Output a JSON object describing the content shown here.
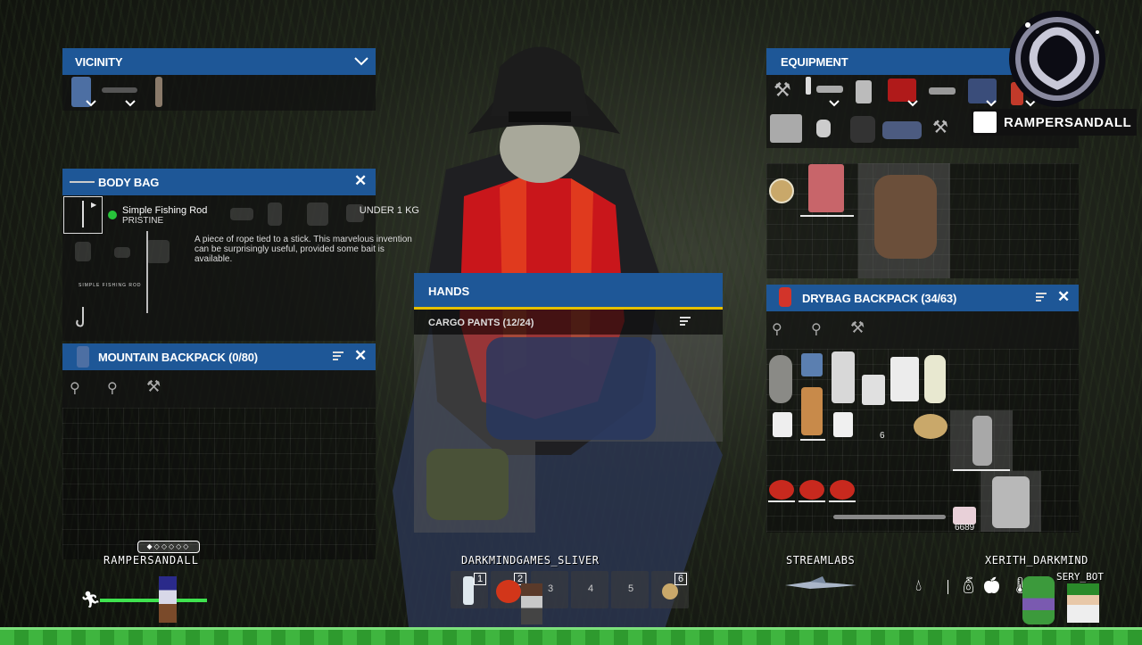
{
  "vicinity": {
    "title": "VICINITY"
  },
  "equipment": {
    "title": "EQUIPMENT"
  },
  "body_bag": {
    "title": "BODY BAG",
    "item_name": "Simple Fishing Rod",
    "item_condition": "PRISTINE",
    "weight": "UNDER 1 KG",
    "description": "A piece of rope tied to a stick. This marvelous invention can be surprisingly useful, provided some bait is available.",
    "card_caption": "SIMPLE FISHING ROD"
  },
  "mountain_backpack": {
    "title": "MOUNTAIN BACKPACK (0/80)"
  },
  "hands": {
    "title": "HANDS",
    "sub_title": "CARGO PANTS (12/24)"
  },
  "drybag": {
    "title": "DRYBAG BACKPACK (34/63)",
    "stack_count": "6",
    "money_count": "6689"
  },
  "overlay": {
    "brand": "RAMPERSANDALL",
    "player_left": "RAMPERSANDALL",
    "player_center": "DARKMINDGAMES_SLIVER",
    "player_streamlabs": "STREAMLABS",
    "player_right": "XERITH_DARKMIND",
    "player_bot": "SERY_BOT"
  },
  "hotbar": {
    "slots": [
      "1",
      "2",
      "3",
      "4",
      "5",
      "6"
    ]
  },
  "colors": {
    "header_blue": "#1e5797",
    "hands_accent": "#e6c000",
    "ground_green": "#3fb53f"
  }
}
